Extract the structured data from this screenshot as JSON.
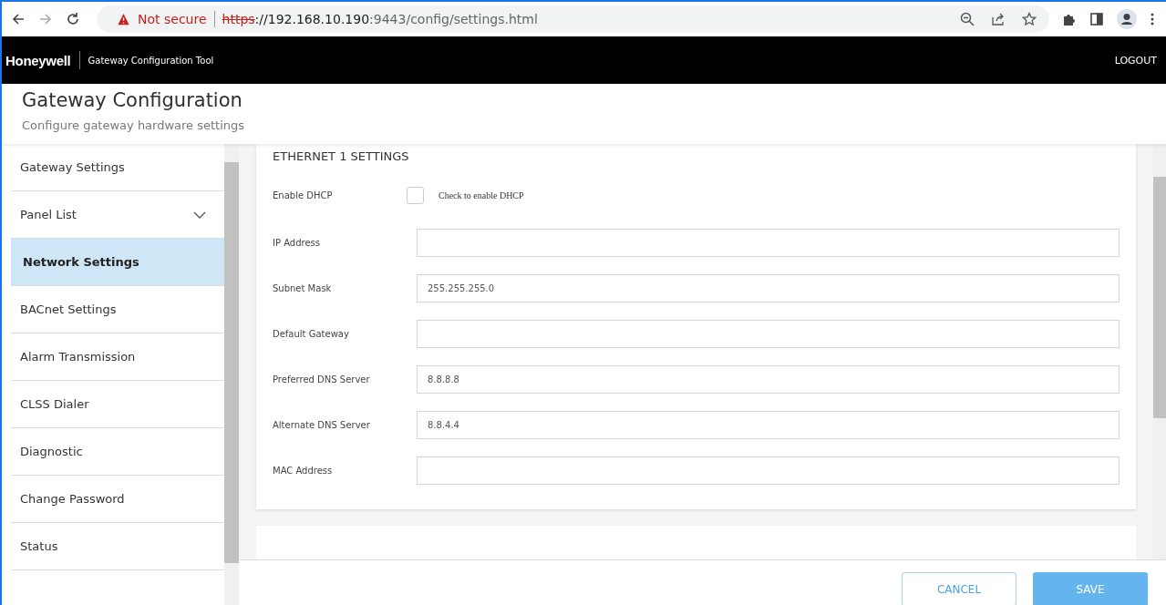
{
  "browser": {
    "security": "Not secure",
    "url_scheme": "https",
    "url_rest": "://192.168.10.190",
    "url_port": ":9443/config/settings.html"
  },
  "header": {
    "brand": "Honeywell",
    "app_title": "Gateway Configuration Tool",
    "logout": "LOGOUT"
  },
  "page": {
    "title": "Gateway Configuration",
    "subtitle": "Configure gateway hardware settings"
  },
  "sidebar": {
    "items": [
      {
        "label": "Gateway Settings",
        "selected": false
      },
      {
        "label": "Panel List",
        "selected": false,
        "expanded": false
      },
      {
        "label": "Network Settings",
        "selected": true
      },
      {
        "label": "BACnet Settings",
        "selected": false
      },
      {
        "label": "Alarm Transmission",
        "selected": false
      },
      {
        "label": "CLSS Dialer",
        "selected": false
      },
      {
        "label": "Diagnostic",
        "selected": false
      },
      {
        "label": "Change Password",
        "selected": false
      },
      {
        "label": "Status",
        "selected": false
      }
    ]
  },
  "section": {
    "title": "ETHERNET 1 SETTINGS",
    "dhcp": {
      "label": "Enable DHCP",
      "checked": false,
      "hint": "Check to enable DHCP"
    },
    "fields": [
      {
        "label": "IP Address"
      },
      {
        "label": "Subnet Mask",
        "value": "255.255.255.0"
      },
      {
        "label": "Default Gateway"
      },
      {
        "label": "Preferred DNS Server",
        "value": "8.8.8.8"
      },
      {
        "label": "Alternate DNS Server",
        "value": "8.8.4.4"
      },
      {
        "label": "MAC Address"
      }
    ]
  },
  "footer": {
    "cancel": "CANCEL",
    "save": "SAVE"
  }
}
